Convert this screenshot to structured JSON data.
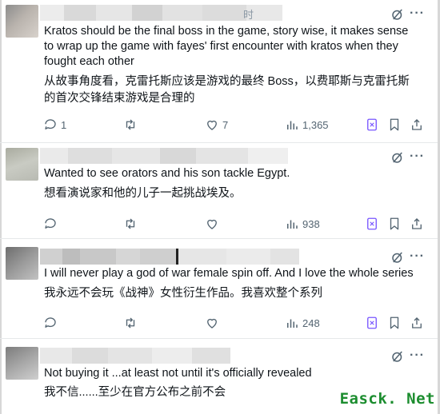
{
  "colors": {
    "text": "#0f1419",
    "muted": "#536471",
    "accent_icon": "#7856ff",
    "watermark": "#1c8d2f"
  },
  "tweets": [
    {
      "name_tail": "时",
      "body_en": "Kratos should be the final boss in the game, story wise, it makes sense to wrap up the game with fayes' first encounter with kratos when they fought each other",
      "body_zh": "从故事角度看，克雷托斯应该是游戏的最终 Boss，以费耶斯与克雷托斯的首次交锋结束游戏是合理的",
      "replies": "1",
      "retweets": "",
      "likes": "7",
      "views": "1,365"
    },
    {
      "name_tail": "",
      "body_en": "Wanted to see orators and his son tackle Egypt.",
      "body_zh": "想看演说家和他的儿子一起挑战埃及。",
      "replies": "",
      "retweets": "",
      "likes": "",
      "views": "938"
    },
    {
      "name_tail": "",
      "body_en": "I will never play a god of war female spin off. And I love the whole series",
      "body_zh": "我永远不会玩《战神》女性衍生作品。我喜欢整个系列",
      "replies": "",
      "retweets": "",
      "likes": "",
      "views": "248"
    },
    {
      "name_tail": "",
      "body_en": "Not buying it ...at least not until it's officially revealed",
      "body_zh": "我不信......至少在官方公布之前不会",
      "replies": "",
      "retweets": "",
      "likes": "",
      "views": ""
    }
  ],
  "watermark": "Easck. Net",
  "icons": [
    "grok-icon",
    "more-icon",
    "reply-icon",
    "retweet-icon",
    "like-icon",
    "views-icon",
    "grok-analyze-icon",
    "bookmark-icon",
    "share-icon"
  ]
}
